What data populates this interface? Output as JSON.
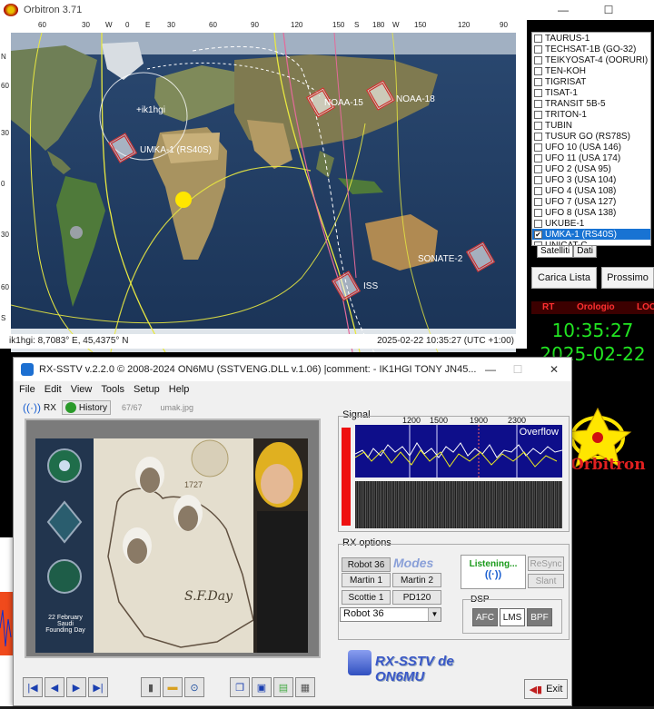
{
  "orbitron": {
    "title": "Orbitron 3.71",
    "window_controls": {
      "minimize": "—",
      "maximize": "☐",
      "close": "✕"
    },
    "map": {
      "top_ticks": [
        "60",
        "30",
        "W",
        "0",
        "E",
        "30",
        "60",
        "90",
        "120",
        "150",
        "S",
        "180",
        "W",
        "150",
        "120",
        "90"
      ],
      "left_ticks": [
        "N",
        "60",
        "30",
        "0",
        "30",
        "60",
        "S"
      ],
      "labels": {
        "noaa15": "NOAA-15",
        "noaa18": "NOAA-18",
        "observer": "+ik1hgi",
        "umka": "UMKA-1 (RS40S)",
        "sonate": "SONATE-2",
        "iss": "ISS"
      }
    },
    "status_left": "ik1hgi: 8,7083° E, 45,4375° N",
    "status_right": "2025-02-22 10:35:27 (UTC +1:00)",
    "satellites": [
      {
        "name": "TAURUS-1",
        "checked": false
      },
      {
        "name": "TECHSAT-1B (GO-32)",
        "checked": false
      },
      {
        "name": "TEIKYOSAT-4 (OORURI)",
        "checked": false
      },
      {
        "name": "TEN-KOH",
        "checked": false
      },
      {
        "name": "TIGRISAT",
        "checked": false
      },
      {
        "name": "TISAT-1",
        "checked": false
      },
      {
        "name": "TRANSIT 5B-5",
        "checked": false
      },
      {
        "name": "TRITON-1",
        "checked": false
      },
      {
        "name": "TUBIN",
        "checked": false
      },
      {
        "name": "TUSUR GO (RS78S)",
        "checked": false
      },
      {
        "name": "UFO 10 (USA 146)",
        "checked": false
      },
      {
        "name": "UFO 11 (USA 174)",
        "checked": false
      },
      {
        "name": "UFO 2 (USA 95)",
        "checked": false
      },
      {
        "name": "UFO 3 (USA 104)",
        "checked": false
      },
      {
        "name": "UFO 4 (USA 108)",
        "checked": false
      },
      {
        "name": "UFO 7 (USA 127)",
        "checked": false
      },
      {
        "name": "UFO 8 (USA 138)",
        "checked": false
      },
      {
        "name": "UKUBE-1",
        "checked": false
      },
      {
        "name": "UMKA-1 (RS40S)",
        "checked": true
      },
      {
        "name": "UNICAT-C",
        "checked": false
      }
    ],
    "tabs": [
      "Satelliti",
      "Dati"
    ],
    "load_list_button": "Carica Lista",
    "next_button": "Prossimo",
    "clock_headers": [
      "RT",
      "Orologio",
      "LOC"
    ],
    "time": "10:35:27",
    "date": "2025-02-22",
    "brand": "Orbitron"
  },
  "rxsstv": {
    "title": "RX-SSTV v.2.2.0 © 2008-2024 ON6MU (SSTVENG.DLL v.1.06) |comment: - IK1HGI TONY JN45...",
    "window_controls": {
      "minimize": "—",
      "maximize": "☐",
      "close": "✕"
    },
    "menu": [
      "File",
      "Edit",
      "View",
      "Tools",
      "Setup",
      "Help"
    ],
    "toolbar": {
      "rx": "RX",
      "history": "History",
      "counter": "67/67",
      "filename": "umak.jpg"
    },
    "image": {
      "year": "1727",
      "left_caption": "22 February\nSaudi\nFounding Day",
      "signature": "S.F.Day"
    },
    "signal": {
      "label": "Signal",
      "freqs": [
        "1200",
        "1500",
        "1900",
        "2300"
      ],
      "overflow": "Overflow"
    },
    "rx_options": {
      "label": "RX options",
      "modes_title": "Modes",
      "modes": [
        "Robot 36",
        "Martin 1",
        "Martin 2",
        "Scottie 1",
        "PD120"
      ],
      "selected_mode": "Robot 36",
      "listening": "Listening...",
      "resync": "ReSync",
      "slant": "Slant",
      "dsp_label": "DSP",
      "dsp_buttons": [
        "AFC",
        "LMS",
        "BPF"
      ]
    },
    "logo_text": "RX-SSTV de ON6MU",
    "exit_button": "Exit",
    "nav_buttons": [
      "first",
      "prev",
      "next",
      "last"
    ]
  }
}
